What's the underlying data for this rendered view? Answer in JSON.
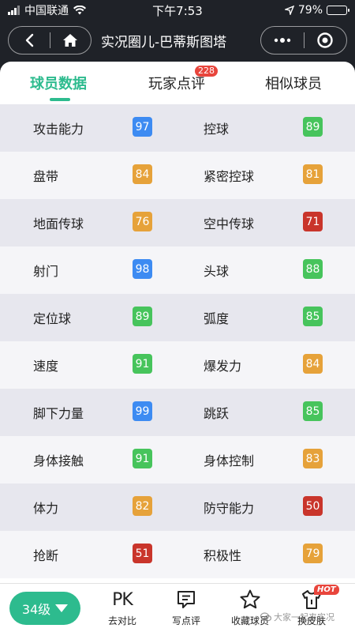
{
  "status_bar": {
    "carrier": "中国联通",
    "time": "下午7:53",
    "battery": "79%",
    "battery_level": 0.79
  },
  "nav": {
    "title": "实况圈儿-巴蒂斯图塔",
    "icons": [
      "back-icon",
      "home-icon",
      "more-icon",
      "close-target-icon"
    ]
  },
  "tabs": [
    {
      "label": "球员数据",
      "active": true
    },
    {
      "label": "玩家点评",
      "badge": "228"
    },
    {
      "label": "相似球员"
    }
  ],
  "colors": {
    "accent": "#2dbb8e",
    "blue": "#3d8bf2",
    "green": "#47c45c",
    "orange": "#e6a23a",
    "red": "#c9352b"
  },
  "stats": [
    {
      "left": {
        "label": "攻击能力",
        "value": "97",
        "color": "blue"
      },
      "right": {
        "label": "控球",
        "value": "89",
        "color": "green"
      }
    },
    {
      "left": {
        "label": "盘带",
        "value": "84",
        "color": "orange"
      },
      "right": {
        "label": "紧密控球",
        "value": "81",
        "color": "orange"
      }
    },
    {
      "left": {
        "label": "地面传球",
        "value": "76",
        "color": "orange"
      },
      "right": {
        "label": "空中传球",
        "value": "71",
        "color": "red"
      }
    },
    {
      "left": {
        "label": "射门",
        "value": "98",
        "color": "blue"
      },
      "right": {
        "label": "头球",
        "value": "88",
        "color": "green"
      }
    },
    {
      "left": {
        "label": "定位球",
        "value": "89",
        "color": "green"
      },
      "right": {
        "label": "弧度",
        "value": "85",
        "color": "green"
      }
    },
    {
      "left": {
        "label": "速度",
        "value": "91",
        "color": "green"
      },
      "right": {
        "label": "爆发力",
        "value": "84",
        "color": "orange"
      }
    },
    {
      "left": {
        "label": "脚下力量",
        "value": "99",
        "color": "blue"
      },
      "right": {
        "label": "跳跃",
        "value": "85",
        "color": "green"
      }
    },
    {
      "left": {
        "label": "身体接触",
        "value": "91",
        "color": "green"
      },
      "right": {
        "label": "身体控制",
        "value": "83",
        "color": "orange"
      }
    },
    {
      "left": {
        "label": "体力",
        "value": "82",
        "color": "orange"
      },
      "right": {
        "label": "防守能力",
        "value": "50",
        "color": "red"
      }
    },
    {
      "left": {
        "label": "抢断",
        "value": "51",
        "color": "red"
      },
      "right": {
        "label": "积极性",
        "value": "79",
        "color": "orange"
      }
    }
  ],
  "bottom_bar": {
    "level_label": "34级",
    "pk_glyph": "PK",
    "items": [
      {
        "label": "去对比",
        "icon": "pk-icon"
      },
      {
        "label": "写点评",
        "icon": "comment-icon"
      },
      {
        "label": "收藏球员",
        "icon": "star-icon"
      },
      {
        "label": "换皮肤",
        "icon": "shirt-icon",
        "badge": "HOT"
      }
    ],
    "watermark": "大家一起来实况"
  }
}
